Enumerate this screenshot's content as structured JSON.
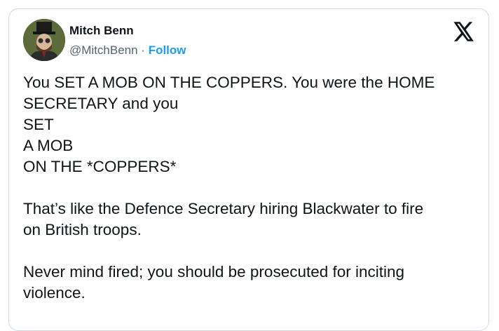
{
  "author": {
    "name": "Mitch Benn",
    "handle": "@MitchBenn",
    "separator": " · ",
    "follow_label": "Follow"
  },
  "icons": {
    "avatar": "profile-photo",
    "logo": "x-logo-icon"
  },
  "colors": {
    "follow": "#1d9bf0",
    "text": "#0f1419",
    "secondary": "#536471",
    "border": "#cfd9de"
  },
  "tweet": {
    "para1": [
      "You SET A MOB ON THE COPPERS. You were the HOME",
      "SECRETARY and you",
      "SET",
      "A MOB",
      "ON THE *COPPERS*"
    ],
    "para2": [
      "That’s like the Defence Secretary hiring Blackwater to fire",
      "on British troops."
    ],
    "para3": [
      "Never mind fired; you should be prosecuted for inciting",
      "violence."
    ]
  }
}
